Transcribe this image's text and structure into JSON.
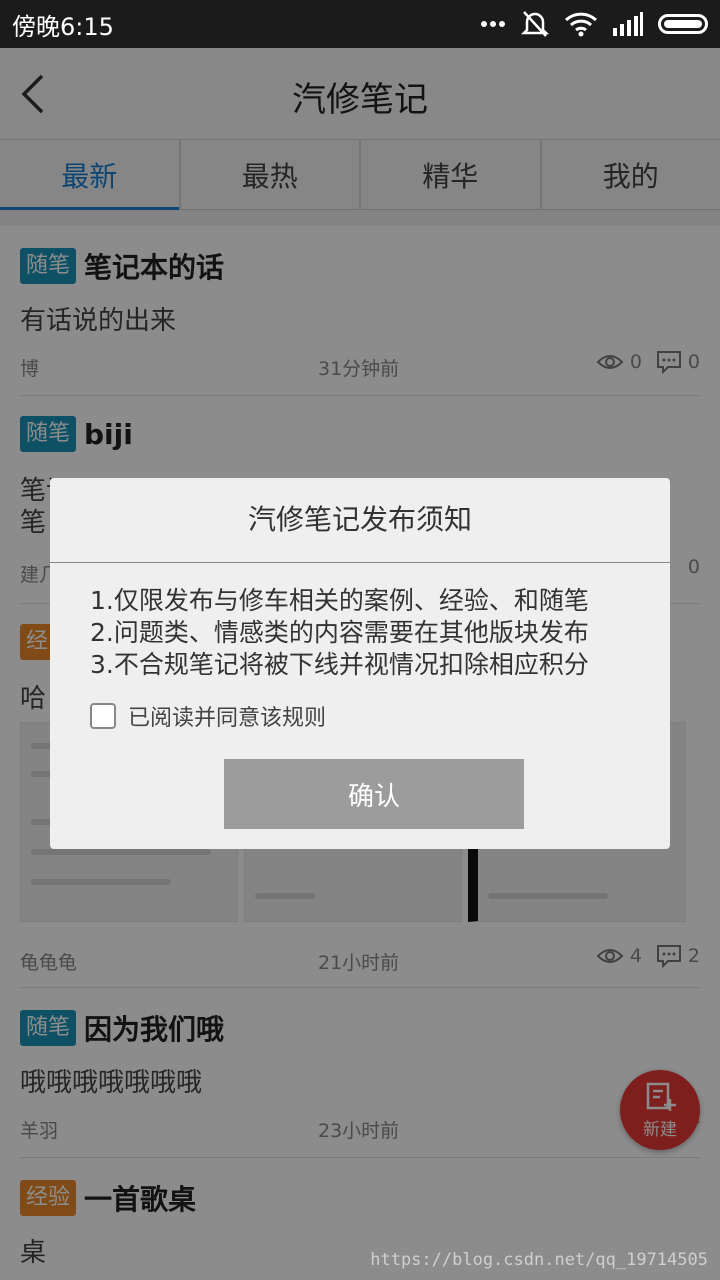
{
  "status_bar": {
    "time": "傍晚6:15"
  },
  "app_bar": {
    "title": "汽修笔记"
  },
  "tabs": [
    {
      "label": "最新",
      "active": true
    },
    {
      "label": "最热",
      "active": false
    },
    {
      "label": "精华",
      "active": false
    },
    {
      "label": "我的",
      "active": false
    }
  ],
  "posts": [
    {
      "tag": "随笔",
      "tag_color": "#1a94b8",
      "title": "笔记本的话",
      "body": "有话说的出来",
      "author": "博",
      "time": "31分钟前",
      "views": "0",
      "comments": "0"
    },
    {
      "tag": "随笔",
      "tag_color": "#1a94b8",
      "title": "biji",
      "body_lines": [
        "笔记",
        "笔"
      ],
      "author": "建几",
      "comments": "0"
    },
    {
      "tag": "经",
      "tag_color": "#e9892b",
      "body": "哈",
      "author": "龟龟龟",
      "time": "21小时前",
      "views": "4",
      "comments": "2"
    },
    {
      "tag": "随笔",
      "tag_color": "#1a94b8",
      "title": "因为我们哦",
      "body": "哦哦哦哦哦哦哦",
      "author": "羊羽",
      "time": "23小时前"
    },
    {
      "tag": "经验",
      "tag_color": "#e9892b",
      "title": "一首歌桌",
      "body": "桌"
    }
  ],
  "fab": {
    "label": "新建"
  },
  "dialog": {
    "title": "汽修笔记发布须知",
    "rules": [
      "1.仅限发布与修车相关的案例、经验、和随笔",
      "2.问题类、情感类的内容需要在其他版块发布",
      "3.不合规笔记将被下线并视情况扣除相应积分"
    ],
    "agree_label": "已阅读并同意该规则",
    "agree_checked": false,
    "confirm_label": "确认"
  },
  "watermark": "https://blog.csdn.net/qq_19714505"
}
